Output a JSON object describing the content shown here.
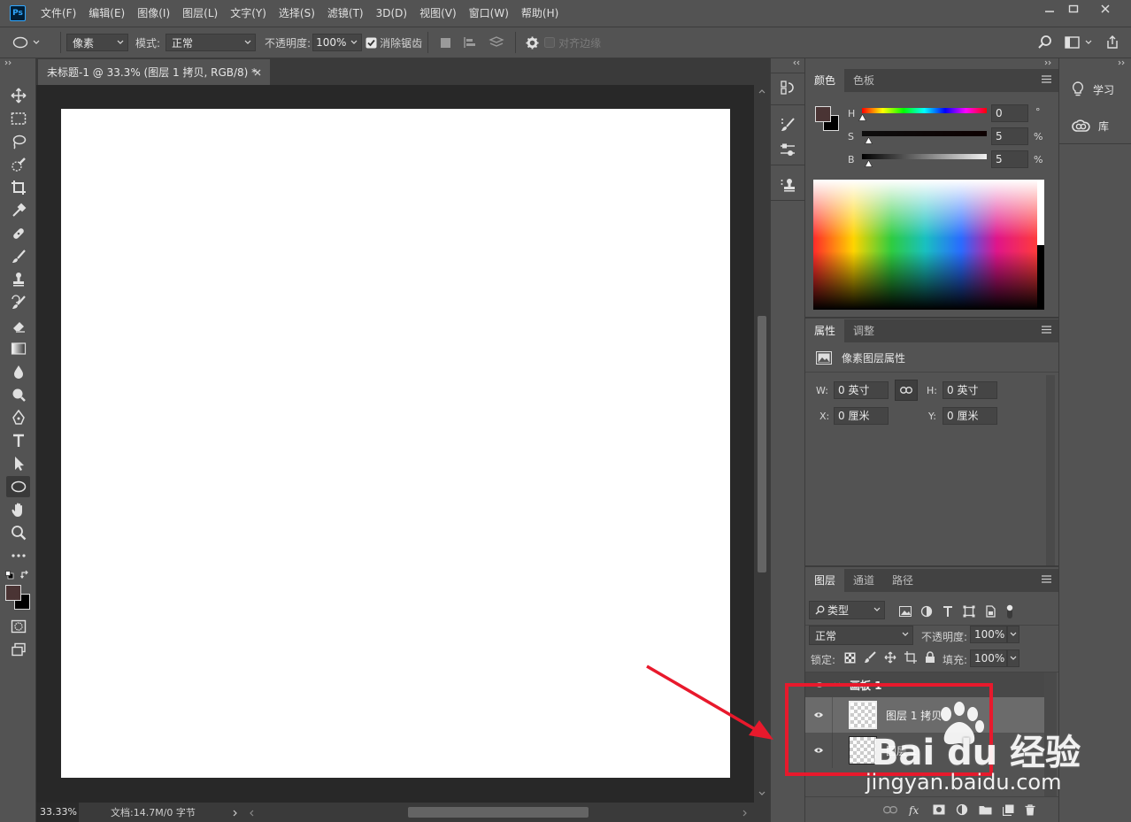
{
  "app": {
    "logo": "Ps"
  },
  "menu": [
    "文件(F)",
    "编辑(E)",
    "图像(I)",
    "图层(L)",
    "文字(Y)",
    "选择(S)",
    "滤镜(T)",
    "3D(D)",
    "视图(V)",
    "窗口(W)",
    "帮助(H)"
  ],
  "options": {
    "shape_mode": "像素",
    "mode_label": "模式:",
    "mode_value": "正常",
    "opacity_label": "不透明度:",
    "opacity_value": "100%",
    "antialias_label": "消除锯齿",
    "align_edges_label": "对齐边缘"
  },
  "document": {
    "tab_title": "未标题-1 @ 33.3% (图层 1 拷贝, RGB/8) *",
    "zoom": "33.33%",
    "doc_info": "文档:14.7M/0 字节"
  },
  "colors": {
    "foreground": "#4a3434",
    "background": "#000000",
    "annotation": "#e8192c"
  },
  "color_panel": {
    "tabs": [
      "颜色",
      "色板"
    ],
    "h_label": "H",
    "h_value": "0",
    "h_unit": "°",
    "s_label": "S",
    "s_value": "5",
    "s_unit": "%",
    "b_label": "B",
    "b_value": "5",
    "b_unit": "%"
  },
  "properties_panel": {
    "tabs": [
      "属性",
      "调整"
    ],
    "title": "像素图层属性",
    "w_label": "W:",
    "w_value": "0 英寸",
    "h_label": "H:",
    "h_value": "0 英寸",
    "x_label": "X:",
    "x_value": "0 厘米",
    "y_label": "Y:",
    "y_value": "0 厘米"
  },
  "layers_panel": {
    "tabs": [
      "图层",
      "通道",
      "路径"
    ],
    "filter_value": "类型",
    "blend_value": "正常",
    "opacity_label": "不透明度:",
    "opacity_value": "100%",
    "lock_label": "锁定:",
    "fill_label": "填充:",
    "fill_value": "100%",
    "artboard_name": "画板 1",
    "layers": [
      {
        "name": "图层 1 拷贝"
      },
      {
        "name": "图层 1"
      }
    ]
  },
  "side_panel": {
    "learn": "学习",
    "libraries": "库"
  },
  "watermark": {
    "logo": "Bai du 经验",
    "url": "jingyan.baidu.com"
  }
}
